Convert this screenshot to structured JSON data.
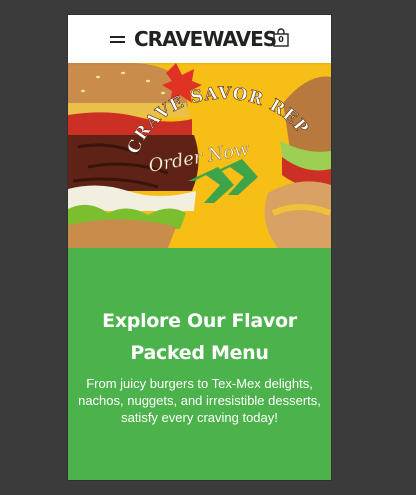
{
  "header": {
    "brand": "CRAVEWAVES",
    "cart_count": "0",
    "menu_icon": "hamburger-menu-icon",
    "cart_icon": "shopping-bag-icon"
  },
  "hero": {
    "tagline": "CRAVE SAVOR REPEAT",
    "cta": "Order Now",
    "background_color": "#f7bf16",
    "accent_color": "#4cb34c"
  },
  "section": {
    "title": "Explore Our Flavor Packed Menu",
    "description": "From juicy burgers to Tex-Mex delights, nachos, nuggets, and irresistible desserts, satisfy every craving today!",
    "background_color": "#4cb34c"
  }
}
